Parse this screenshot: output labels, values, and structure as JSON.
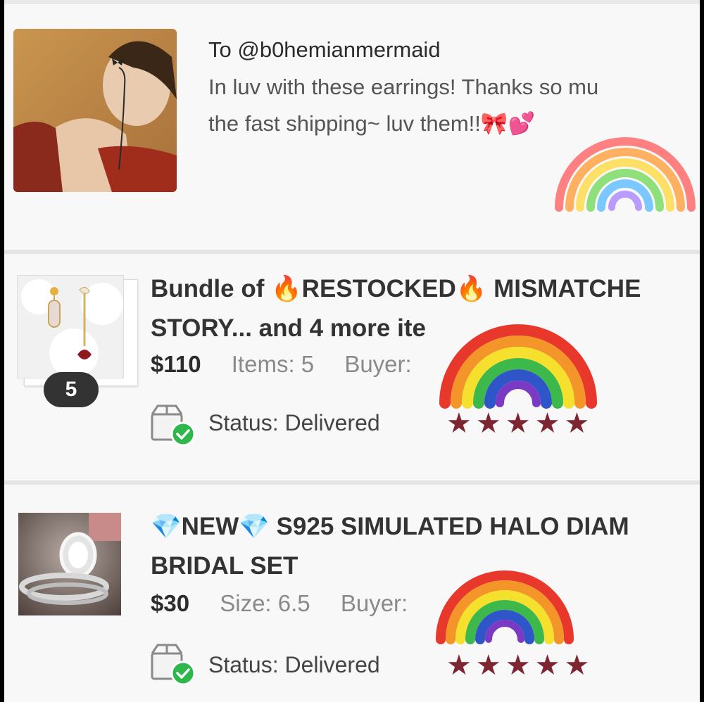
{
  "note": {
    "to": "To @b0hemianmermaid",
    "message_line1": "In luv with these earrings! Thanks so mu",
    "message_line2": "the fast shipping~ luv them!!🎀💕"
  },
  "orders": [
    {
      "title_line1": "Bundle of 🔥RESTOCKED🔥 MISMATCHE",
      "title_line2": "STORY... and 4 more ite",
      "price": "$110",
      "detail": "Items: 5",
      "buyer_label": "Buyer:",
      "status": "Status:  Delivered",
      "bundle_count": "5",
      "rating_stars": 5,
      "stars_text": "★★★★★"
    },
    {
      "title_line1": "💎NEW💎 S925 SIMULATED HALO DIAM",
      "title_line2": "BRIDAL SET",
      "price": "$30",
      "detail": "Size: 6.5",
      "buyer_label": "Buyer:",
      "status": "Status:  Delivered",
      "rating_stars": 5,
      "stars_text": "★★★★★"
    }
  ],
  "icons": {
    "status": "package-delivered-icon",
    "rating": "star-icon",
    "sticker": "rainbow-sticker"
  },
  "colors": {
    "star": "#7d2531",
    "delivered_check": "#2eb84b",
    "badge": "#333333"
  }
}
